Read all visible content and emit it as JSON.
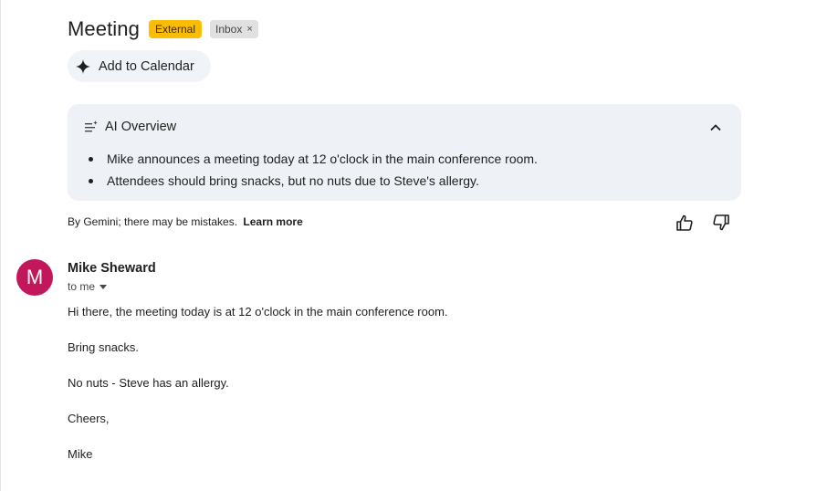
{
  "header": {
    "subject": "Meeting",
    "labels": {
      "external": "External",
      "inbox": "Inbox",
      "remove": "×"
    },
    "add_to_calendar": "Add to Calendar"
  },
  "ai_overview": {
    "title": "AI Overview",
    "bullets": [
      "Mike announces a meeting today at 12 o'clock in the main conference room.",
      "Attendees should bring snacks, but no nuts due to Steve's allergy."
    ],
    "disclaimer": "By Gemini; there may be mistakes.",
    "learn_more": "Learn more"
  },
  "message": {
    "avatar_initial": "M",
    "sender": "Mike Sheward",
    "recipient": "to me",
    "body": [
      "Hi there, the meeting today is at 12 o'clock in the main conference room.",
      "Bring snacks.",
      "No nuts - Steve has an allergy.",
      "Cheers,",
      "Mike"
    ]
  },
  "colors": {
    "external_badge": "#fbbc04",
    "avatar": "#c2185b",
    "ai_card": "#eef1f6"
  },
  "icons": {
    "calendar_spark": "sparkle-icon",
    "ai_overview": "summary-list-icon",
    "collapse": "chevron-up-icon",
    "thumbs_up": "thumbs-up-icon",
    "thumbs_down": "thumbs-down-icon",
    "recipient_dropdown": "caret-down-icon"
  }
}
